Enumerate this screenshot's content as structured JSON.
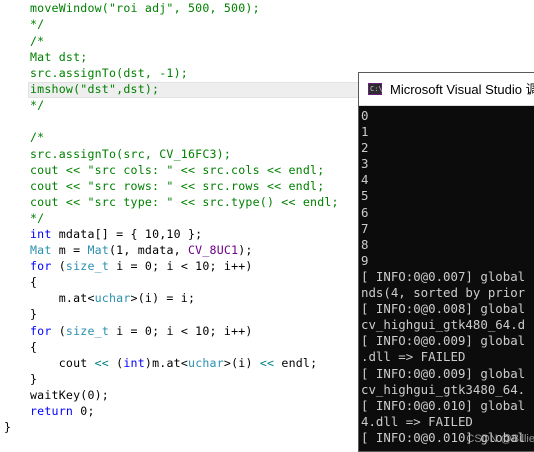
{
  "editor": {
    "lines": [
      [
        {
          "t": "moveWindow(",
          "c": "comment"
        },
        {
          "t": "\"roi adj\"",
          "c": "comment"
        },
        {
          "t": ", 500, 500);",
          "c": "comment"
        }
      ],
      [
        {
          "t": "*/",
          "c": "comment"
        }
      ],
      [
        {
          "t": "/*",
          "c": "comment"
        }
      ],
      [
        {
          "t": "Mat dst;",
          "c": "comment"
        }
      ],
      [
        {
          "t": "src.assignTo(dst, -1);",
          "c": "comment"
        }
      ],
      [
        {
          "t": "imshow(\"dst\",dst);",
          "c": "comment"
        }
      ],
      [
        {
          "t": "*/",
          "c": "comment"
        }
      ],
      [
        {
          "t": "",
          "c": "normal"
        }
      ],
      [
        {
          "t": "/*",
          "c": "comment"
        }
      ],
      [
        {
          "t": "src.assignTo(src, CV_16FC3);",
          "c": "comment"
        }
      ],
      [
        {
          "t": "cout << \"src cols: \" << src.cols << endl;",
          "c": "comment"
        }
      ],
      [
        {
          "t": "cout << \"src rows: \" << src.rows << endl;",
          "c": "comment"
        }
      ],
      [
        {
          "t": "cout << \"src type: \" << src.type() << endl;",
          "c": "comment"
        }
      ],
      [
        {
          "t": "*/",
          "c": "comment"
        }
      ],
      [
        {
          "t": "int",
          "c": "keyword"
        },
        {
          "t": " mdata[] = { 10,10 };",
          "c": "normal"
        }
      ],
      [
        {
          "t": "Mat",
          "c": "type"
        },
        {
          "t": " m = ",
          "c": "normal"
        },
        {
          "t": "Mat",
          "c": "type"
        },
        {
          "t": "(1, mdata, ",
          "c": "normal"
        },
        {
          "t": "CV_8UC1",
          "c": "macro"
        },
        {
          "t": ");",
          "c": "normal"
        }
      ],
      [
        {
          "t": "for",
          "c": "keyword"
        },
        {
          "t": " (",
          "c": "normal"
        },
        {
          "t": "size_t",
          "c": "type"
        },
        {
          "t": " i = 0; i < 10; i++)",
          "c": "normal"
        }
      ],
      [
        {
          "t": "{",
          "c": "normal"
        }
      ],
      [
        {
          "t": "    m.at<",
          "c": "normal"
        },
        {
          "t": "uchar",
          "c": "type"
        },
        {
          "t": ">(i) = i;",
          "c": "normal"
        }
      ],
      [
        {
          "t": "}",
          "c": "normal"
        }
      ],
      [
        {
          "t": "for",
          "c": "keyword"
        },
        {
          "t": " (",
          "c": "normal"
        },
        {
          "t": "size_t",
          "c": "type"
        },
        {
          "t": " i = 0; i < 10; i++)",
          "c": "normal"
        }
      ],
      [
        {
          "t": "{",
          "c": "normal"
        }
      ],
      [
        {
          "t": "    cout ",
          "c": "normal"
        },
        {
          "t": "<<",
          "c": "operator"
        },
        {
          "t": " (",
          "c": "normal"
        },
        {
          "t": "int",
          "c": "keyword"
        },
        {
          "t": ")m.at<",
          "c": "normal"
        },
        {
          "t": "uchar",
          "c": "type"
        },
        {
          "t": ">(i) ",
          "c": "normal"
        },
        {
          "t": "<<",
          "c": "operator"
        },
        {
          "t": " endl;",
          "c": "normal"
        }
      ],
      [
        {
          "t": "}",
          "c": "normal"
        }
      ],
      [
        {
          "t": "waitKey(0);",
          "c": "normal"
        }
      ],
      [
        {
          "t": "return",
          "c": "keyword"
        },
        {
          "t": " 0;",
          "c": "normal"
        }
      ],
      [
        {
          "t": "}",
          "c": "normal"
        }
      ]
    ]
  },
  "console": {
    "title": "Microsoft Visual Studio 调",
    "icon": "visual-studio-console-icon",
    "lines": [
      "0",
      "1",
      "2",
      "3",
      "4",
      "5",
      "6",
      "7",
      "8",
      "9",
      "[ INFO:0@0.007] global",
      "nds(4, sorted by prior",
      "[ INFO:0@0.008] global",
      "cv_highgui_gtk480_64.d",
      "[ INFO:0@0.009] global",
      ".dll => FAILED",
      "[ INFO:0@0.009] global",
      "cv_highgui_gtk3480_64.",
      "[ INFO:0@0.010] global",
      "4.dll => FAILED",
      "[ INFO:0@0.010] global"
    ]
  },
  "watermark": "CSDN @Billie",
  "colors": {
    "comment": "#008000",
    "keyword": "#0000ff",
    "type": "#2b91af",
    "macro": "#6f008a",
    "operator": "#008080",
    "console_bg": "#0c0c0c",
    "console_text": "#cccccc"
  }
}
